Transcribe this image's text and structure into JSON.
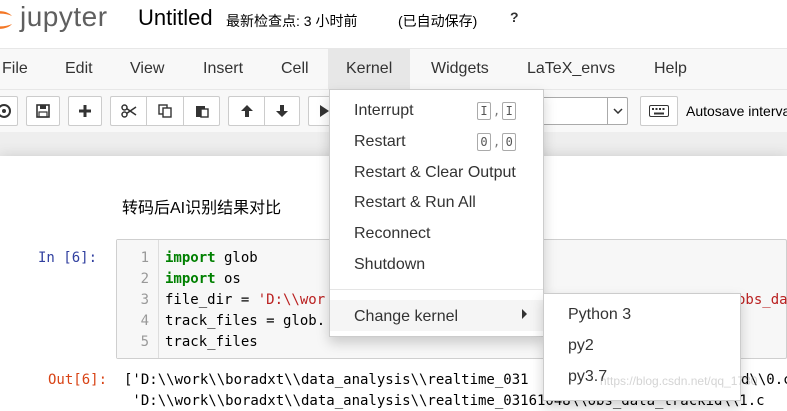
{
  "header": {
    "logo_text": "jupyter",
    "notebook_title": "Untitled",
    "checkpoint_text": "最新检查点: 3 小时前",
    "autosave_status": "(已自动保存)",
    "help_mark": "?"
  },
  "menubar": {
    "items": [
      {
        "label": "File"
      },
      {
        "label": "Edit"
      },
      {
        "label": "View"
      },
      {
        "label": "Insert"
      },
      {
        "label": "Cell"
      },
      {
        "label": "Kernel"
      },
      {
        "label": "Widgets"
      },
      {
        "label": "LaTeX_envs"
      },
      {
        "label": "Help"
      }
    ],
    "active": "Kernel"
  },
  "toolbar": {
    "buttons": [
      {
        "icon": "stop-icon"
      },
      {
        "icon": "save-icon"
      },
      {
        "icon": "plus-icon"
      },
      {
        "icon": "cut-icon"
      },
      {
        "icon": "copy-icon"
      },
      {
        "icon": "paste-icon"
      },
      {
        "icon": "arrow-up-icon"
      },
      {
        "icon": "arrow-down-icon"
      },
      {
        "icon": "run-icon"
      }
    ],
    "cell_type_value": "",
    "keyboard_icon": "keyboard-icon",
    "autosave_label": "Autosave interva"
  },
  "kernel_menu": {
    "items": [
      {
        "label": "Interrupt",
        "shortcut": [
          "I",
          "I"
        ]
      },
      {
        "label": "Restart",
        "shortcut": [
          "0",
          "0"
        ]
      },
      {
        "label": "Restart & Clear Output"
      },
      {
        "label": "Restart & Run All"
      },
      {
        "label": "Reconnect"
      },
      {
        "label": "Shutdown"
      },
      {
        "label": "Change kernel",
        "has_submenu": true
      }
    ],
    "change_kernel_submenu": [
      "Python 3",
      "py2",
      "py3.7"
    ]
  },
  "notebook": {
    "markdown_text": "转码后AI识别结果对比",
    "code_cell": {
      "prompt": "In  [6]:",
      "line_numbers": [
        "1",
        "2",
        "3",
        "4",
        "5"
      ],
      "lines": [
        {
          "kw": "import",
          "rest": " glob"
        },
        {
          "kw": "import",
          "rest": " os"
        },
        {
          "pre": "file_dir = ",
          "str": "'D:\\\\wor",
          "tail": "obs_da"
        },
        {
          "pre": "track_files = glob."
        },
        {
          "pre": "track_files"
        }
      ]
    },
    "output": {
      "prompt": "Out[6]:",
      "lines": [
        "['D:\\\\work\\\\boradxt\\\\data_analysis\\\\realtime_031",
        " 'D:\\\\work\\\\boradxt\\\\data_analysis\\\\realtime_03161048\\\\obs_data_trackid\\\\1.c"
      ],
      "line1_tail": "d\\\\0.c"
    }
  },
  "watermark": "https://blog.csdn.net/qq_1730"
}
